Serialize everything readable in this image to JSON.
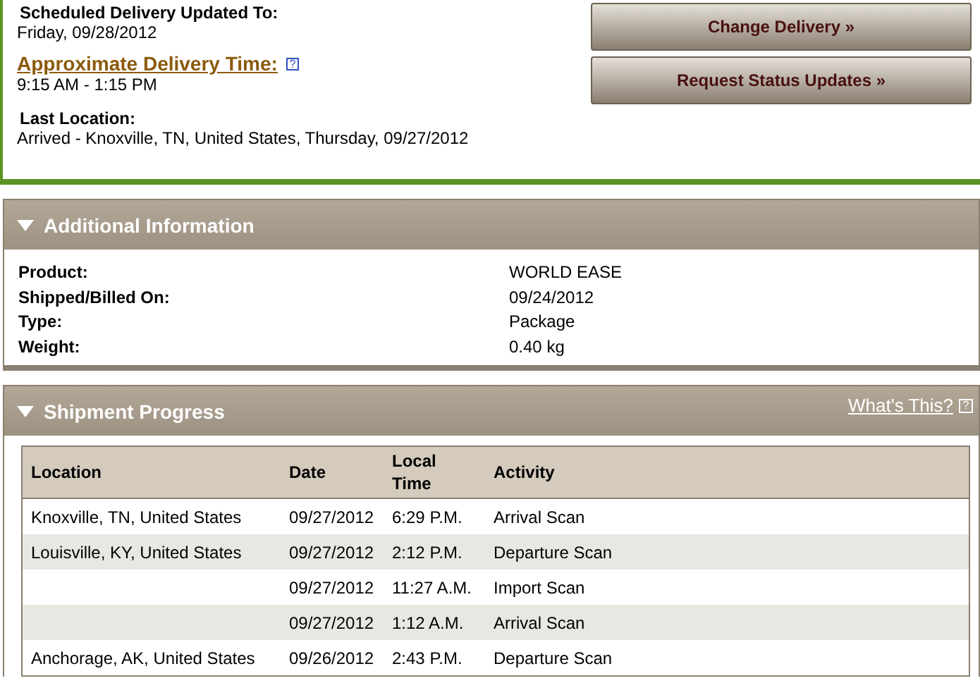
{
  "delivery": {
    "scheduled_label": "Scheduled Delivery Updated To:",
    "scheduled_value": "Friday, 09/28/2012",
    "approx_label": "Approximate Delivery Time:",
    "approx_help": "?",
    "approx_value": "9:15 AM - 1:15 PM",
    "last_label": "Last Location:",
    "last_value": "Arrived - Knoxville, TN, United States, Thursday, 09/27/2012"
  },
  "buttons": [
    "Change Delivery »",
    "Request Status Updates »"
  ],
  "additional_information": {
    "title": "Additional Information",
    "expanded": true,
    "rows": [
      {
        "label": "Product:",
        "value": "WORLD EASE"
      },
      {
        "label": "Shipped/Billed On:",
        "value": "09/24/2012"
      },
      {
        "label": "Type:",
        "value": "Package"
      },
      {
        "label": "Weight:",
        "value": "0.40 kg"
      }
    ]
  },
  "shipment_progress": {
    "title": "Shipment Progress",
    "expanded": true,
    "help_link": "What's This?",
    "help_icon": "?",
    "columns": [
      "Location",
      "Date",
      "Local Time",
      "Activity"
    ],
    "rows": [
      {
        "location": "Knoxville, TN, United States",
        "date": "09/27/2012",
        "time": "6:29 P.M.",
        "activity": "Arrival Scan"
      },
      {
        "location": "Louisville, KY, United States",
        "date": "09/27/2012",
        "time": "2:12 P.M.",
        "activity": "Departure Scan"
      },
      {
        "date": "09/27/2012",
        "time": "11:27 A.M.",
        "activity": "Import Scan"
      },
      {
        "date": "09/27/2012",
        "time": "1:12 A.M.",
        "activity": "Arrival Scan"
      },
      {
        "location": "Anchorage, AK, United States",
        "date": "09/26/2012",
        "time": "2:43 P.M.",
        "activity": "Departure Scan"
      }
    ]
  }
}
